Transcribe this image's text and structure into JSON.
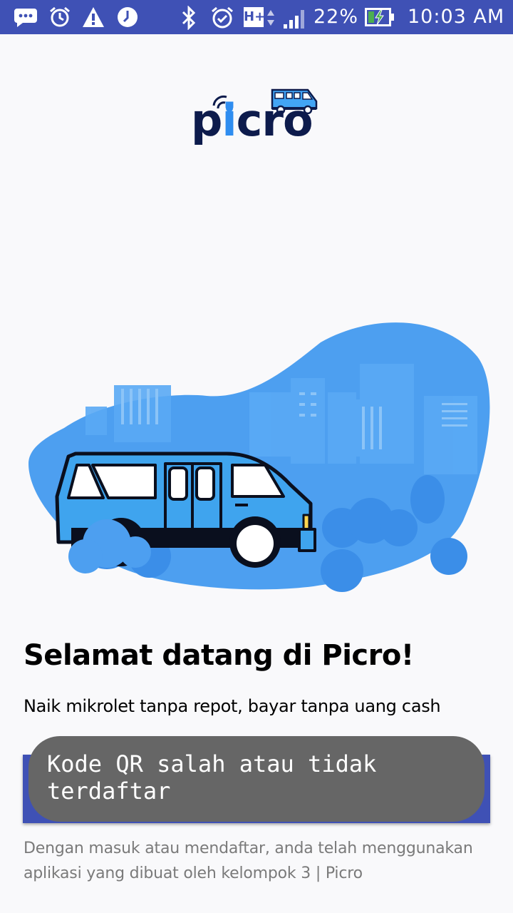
{
  "status_bar": {
    "battery_percent": "22%",
    "time": "10:03 AM",
    "network_type": "H+",
    "background_color": "#3f51b5",
    "icons": [
      "messages-icon",
      "alarm-icon",
      "warning-icon",
      "clock-icon",
      "bluetooth-icon",
      "alarm-clock-icon",
      "network-hplus-icon",
      "signal-icon",
      "battery-charging-icon"
    ]
  },
  "logo": {
    "text_p": "p",
    "text_i": "i",
    "text_rest": "cro",
    "brand_color": "#0d1b4c",
    "accent_color": "#2f8df0"
  },
  "welcome": {
    "title": "Selamat datang di Picro!",
    "subtitle": "Naik mikrolet tanpa repot, bayar tanpa uang cash"
  },
  "primary_button": {
    "color": "#3f51b5"
  },
  "toast": {
    "message": "Kode QR salah atau tidak terdaftar"
  },
  "terms": {
    "text": "Dengan masuk atau mendaftar, anda telah menggunakan aplikasi yang dibuat oleh kelompok 3 | Picro"
  }
}
